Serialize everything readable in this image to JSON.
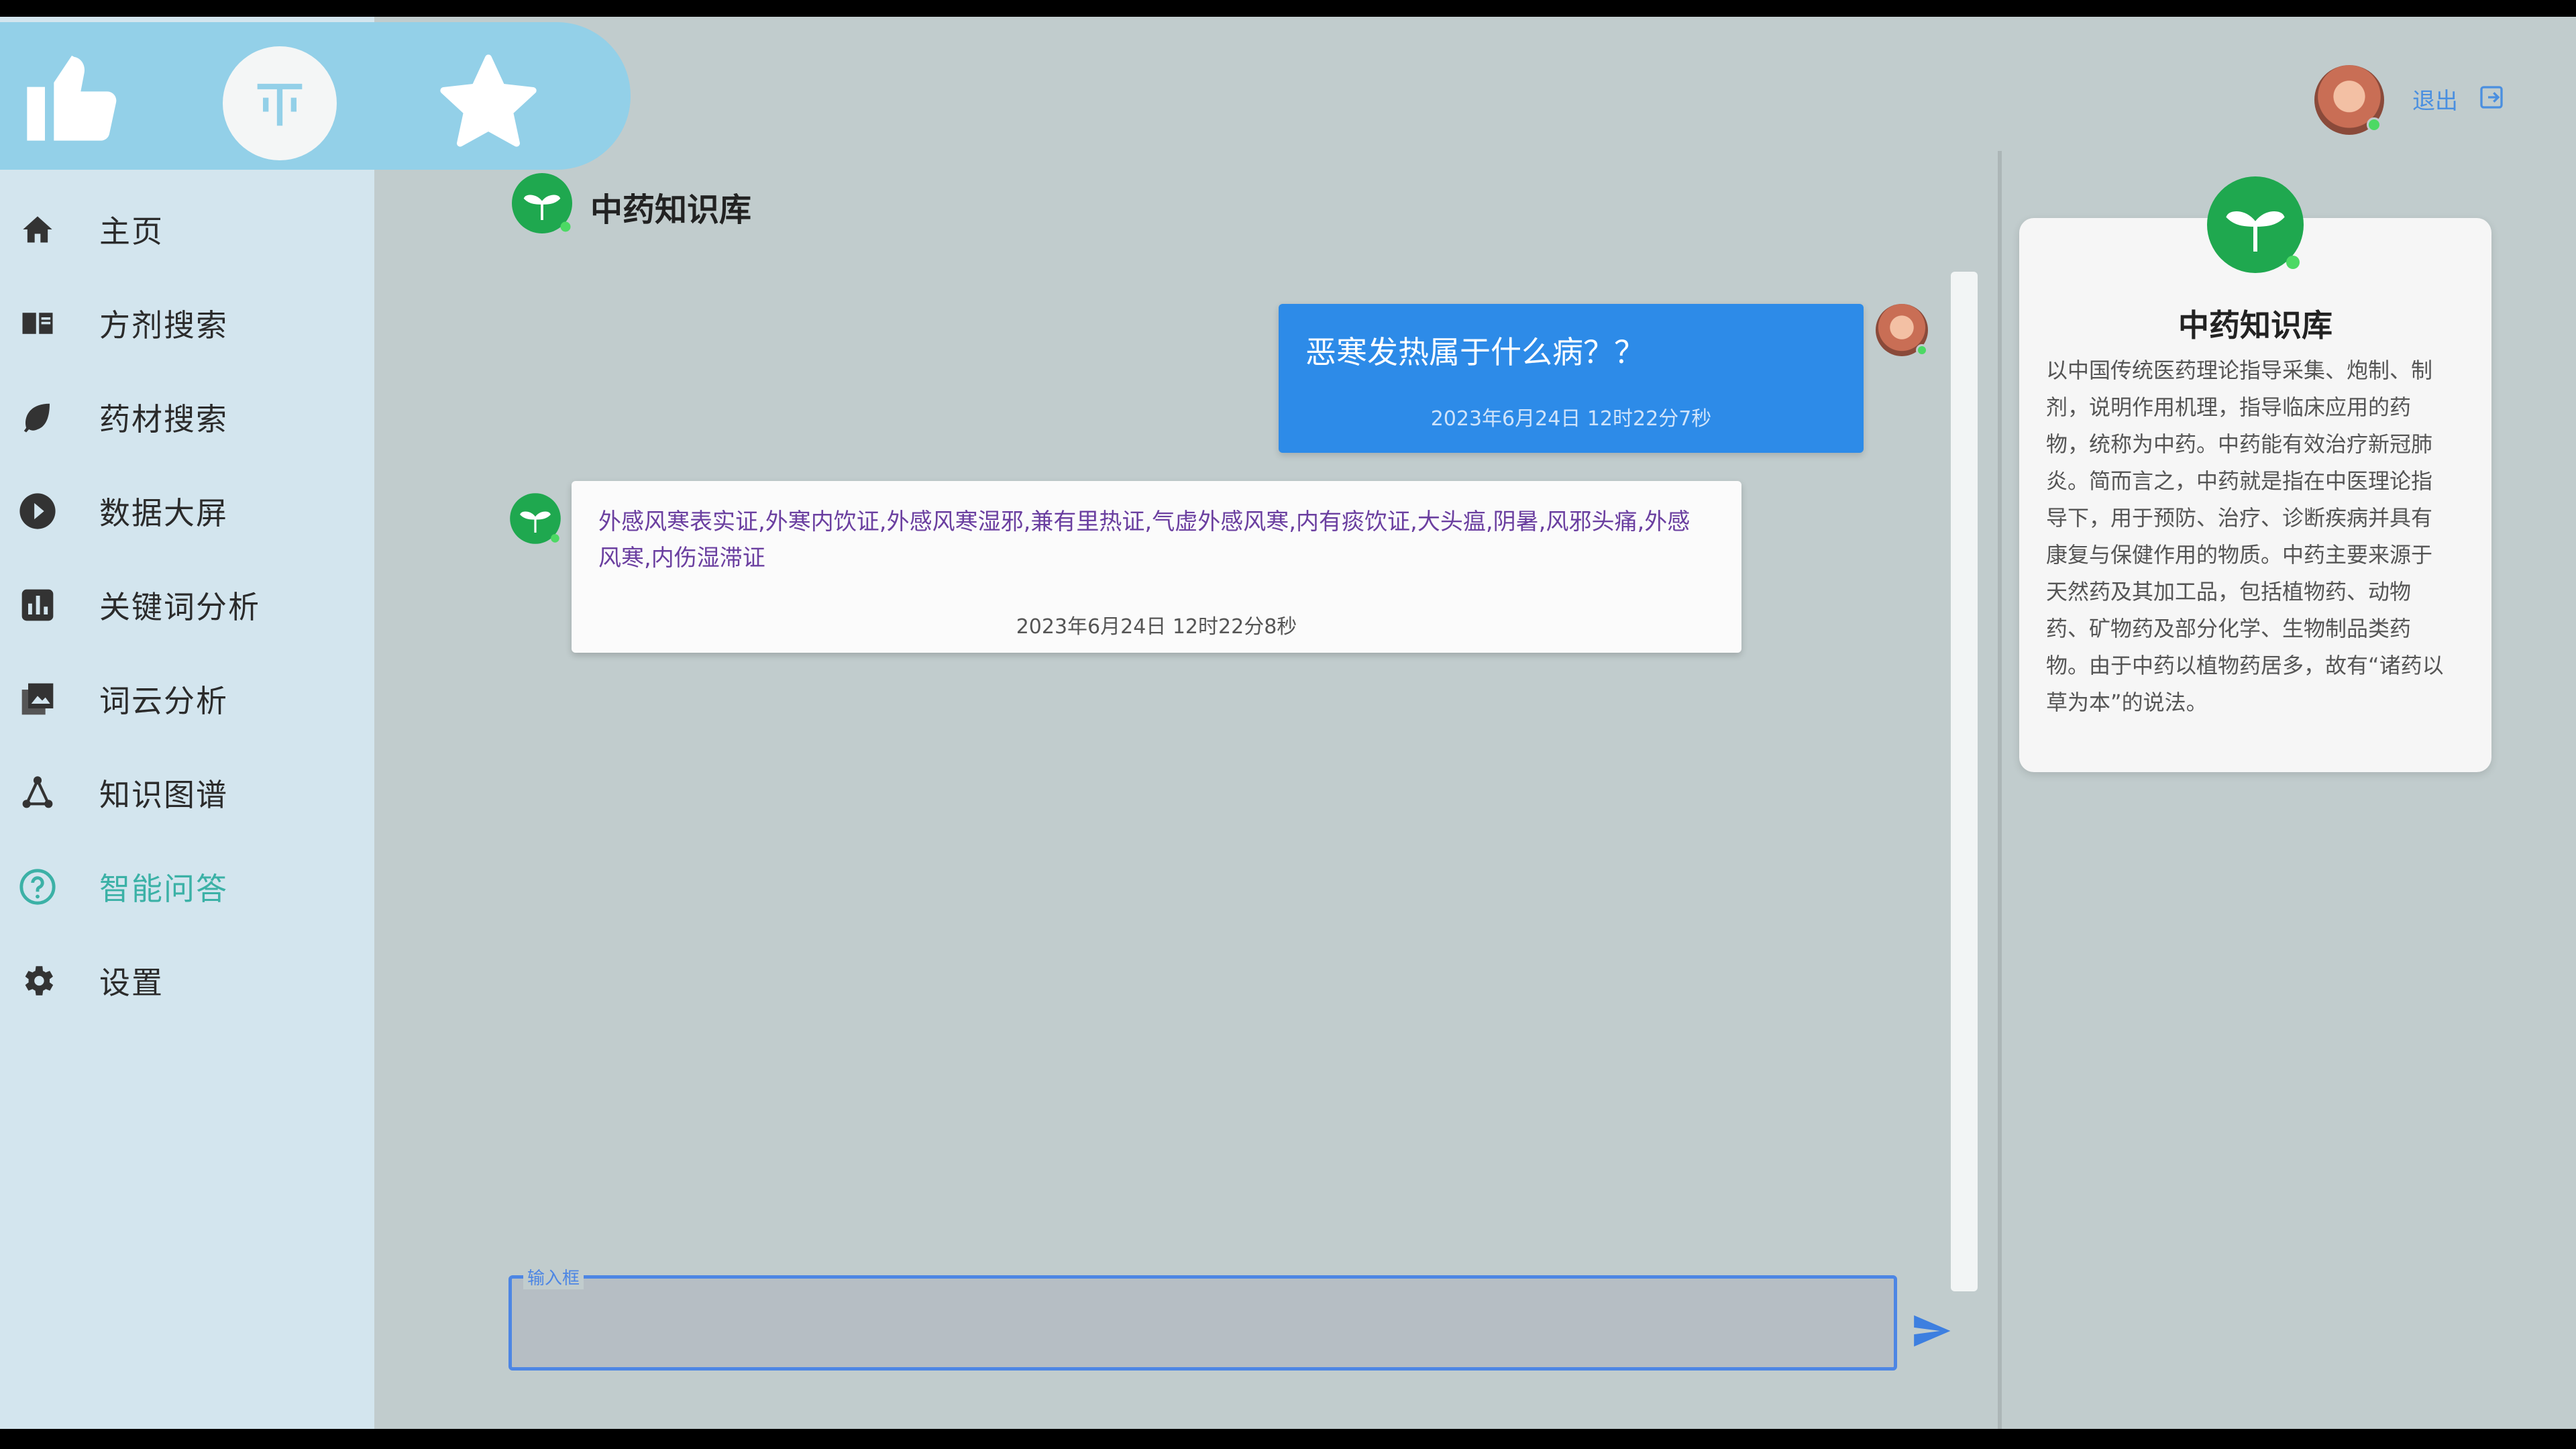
{
  "sidebar": {
    "items": [
      {
        "label": "主页",
        "icon": "home-icon"
      },
      {
        "label": "方剂搜索",
        "icon": "book-icon"
      },
      {
        "label": "药材搜索",
        "icon": "leaf-icon"
      },
      {
        "label": "数据大屏",
        "icon": "play-icon"
      },
      {
        "label": "关键词分析",
        "icon": "bar-chart-icon"
      },
      {
        "label": "词云分析",
        "icon": "image-stack-icon"
      },
      {
        "label": "知识图谱",
        "icon": "graph-icon"
      },
      {
        "label": "智能问答",
        "icon": "question-icon",
        "active": true
      },
      {
        "label": "设置",
        "icon": "gear-icon"
      }
    ]
  },
  "header": {
    "logout_label": "退出"
  },
  "chat": {
    "title": "中药知识库",
    "messages": [
      {
        "from": "user",
        "text": "恶寒发热属于什么病？？",
        "time": "2023年6月24日 12时22分7秒"
      },
      {
        "from": "bot",
        "text": "外感风寒表实证,外寒内饮证,外感风寒湿邪,兼有里热证,气虚外感风寒,内有痰饮证,大头瘟,阴暑,风邪头痛,外感风寒,内伤湿滞证",
        "time": "2023年6月24日 12时22分8秒"
      }
    ],
    "input_label": "输入框",
    "input_value": ""
  },
  "info_card": {
    "title": "中药知识库",
    "description": "以中国传统医药理论指导采集、炮制、制剂，说明作用机理，指导临床应用的药物，统称为中药。中药能有效治疗新冠肺炎。简而言之，中药就是指在中医理论指导下，用于预防、治疗、诊断疾病并具有康复与保健作用的物质。中药主要来源于天然药及其加工品，包括植物药、动物药、矿物药及部分化学、生物制品类药物。由于中药以植物药居多，故有“诸药以草为本”的说法。"
  },
  "colors": {
    "accent": "#2d8be8",
    "active_nav": "#3bb1a6",
    "brand_green": "#1fa84f",
    "bot_text": "#6b3fa0"
  }
}
